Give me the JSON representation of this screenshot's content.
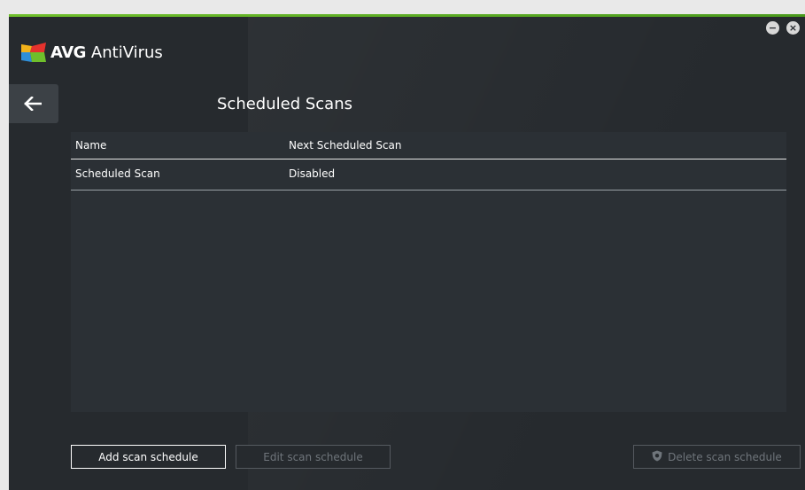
{
  "app": {
    "brand_short": "AVG",
    "brand_product": "AntiVirus",
    "accent_color": "#6fbf2b",
    "window_controls": {
      "minimize": "−",
      "close": "×"
    }
  },
  "page": {
    "title": "Scheduled Scans",
    "back_icon": "arrow-left-icon"
  },
  "table": {
    "columns": [
      "Name",
      "Next Scheduled Scan"
    ],
    "rows": [
      {
        "name": "Scheduled Scan",
        "next": "Disabled"
      }
    ]
  },
  "buttons": {
    "add": "Add scan schedule",
    "edit": "Edit scan schedule",
    "delete": "Delete scan schedule",
    "delete_icon": "shield-icon"
  }
}
